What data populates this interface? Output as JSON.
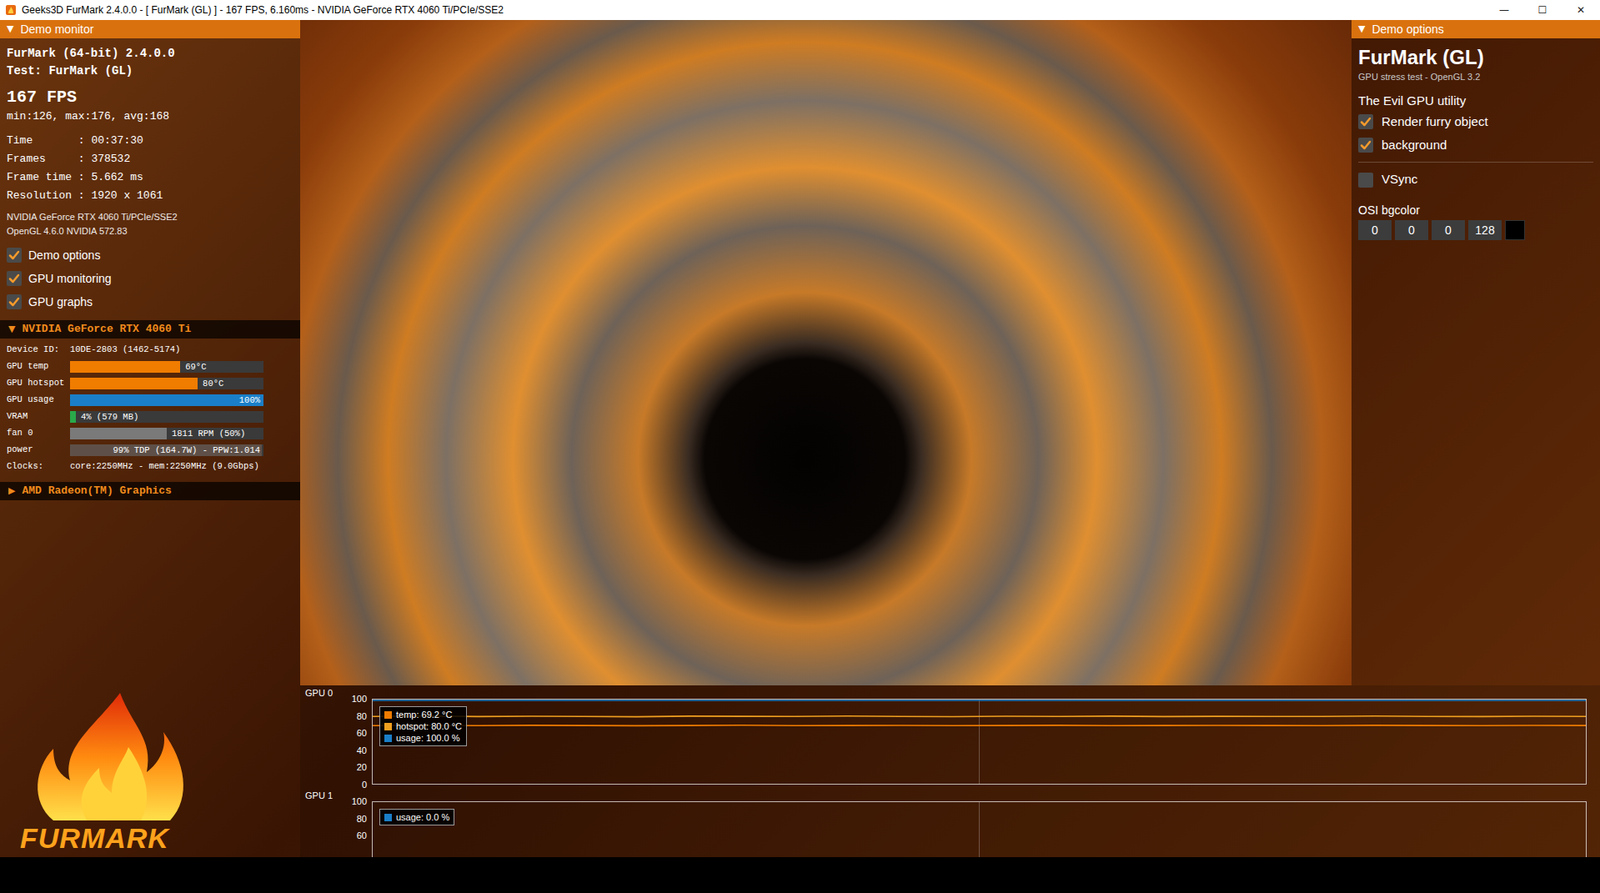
{
  "window": {
    "title": "Geeks3D FurMark 2.4.0.0 - [ FurMark (GL) ] - 167 FPS, 6.160ms - NVIDIA GeForce RTX 4060 Ti/PCIe/SSE2",
    "controls": [
      "—",
      "☐",
      "✕"
    ]
  },
  "demo_monitor": {
    "arrow": "▼",
    "header": "Demo monitor",
    "app": "FurMark (64-bit) 2.4.0.0",
    "test": "Test: FurMark (GL)",
    "fps": "167 FPS",
    "stats": "min:126, max:176, avg:168",
    "info": [
      "Time       : 00:37:30",
      "Frames     : 378532",
      "Frame time : 5.662 ms",
      "Resolution : 1920 x 1061"
    ],
    "renderer": "NVIDIA GeForce RTX 4060 Ti/PCIe/SSE2",
    "opengl": "OpenGL 4.6.0 NVIDIA 572.83",
    "toggles": [
      {
        "label": "Demo options",
        "checked": true
      },
      {
        "label": "GPU monitoring",
        "checked": true
      },
      {
        "label": "GPU graphs",
        "checked": true
      }
    ],
    "gpus": [
      {
        "arrow": "▼",
        "name": "NVIDIA GeForce RTX 4060 Ti",
        "expanded": true,
        "device_label": "Device ID:",
        "device_id": "10DE-2803 (1462-5174)",
        "meters": [
          {
            "label": "GPU temp",
            "level": 0.57,
            "reading": "69°C",
            "color": "#f07c00"
          },
          {
            "label": "GPU hotspot",
            "level": 0.66,
            "reading": "80°C",
            "color": "#f07c00"
          },
          {
            "label": "GPU usage",
            "level": 1.0,
            "reading": "100%",
            "color": "#1a7fc8"
          },
          {
            "label": "VRAM",
            "level": 0.03,
            "reading": "4% (579 MB)",
            "color": "#2aa84a"
          },
          {
            "label": "fan 0",
            "level": 0.5,
            "reading": "1811 RPM (50%)",
            "color": "#7a7a7a"
          },
          {
            "label": "power",
            "level": 0.99,
            "reading": "99% TDP (164.7W) - PPW:1.014",
            "color": "#5e5048"
          }
        ],
        "clocks_label": "Clocks:",
        "clocks": "core:2250MHz - mem:2250MHz (9.0Gbps)"
      },
      {
        "arrow": "▶",
        "name": "AMD Radeon(TM) Graphics",
        "expanded": false
      }
    ]
  },
  "logo": {
    "text": "FURMARK"
  },
  "demo_options": {
    "arrow": "▼",
    "header": "Demo options",
    "title": "FurMark (GL)",
    "subtitle": "GPU stress test - OpenGL 3.2",
    "tagline": "The Evil GPU utility",
    "options": [
      {
        "label": "Render furry object",
        "checked": true
      },
      {
        "label": "background",
        "checked": true
      },
      {
        "label": "VSync",
        "checked": false
      }
    ],
    "bgcolor": {
      "label": "OSI bgcolor",
      "values": [
        "0",
        "0",
        "0",
        "128"
      ],
      "color": "#000000"
    }
  },
  "graphs": [
    {
      "label": "GPU 0",
      "ticks": [
        "100",
        "80",
        "60",
        "40",
        "20",
        "0"
      ],
      "series": [
        {
          "name": "temp",
          "legend": "temp: 69.2 °C",
          "color": "#f07c00",
          "values": [
            69.0,
            69.3,
            69.1,
            69.4,
            69.2,
            68.9,
            69.2,
            69.5,
            69.1,
            69.2,
            69.3,
            69.0,
            69.2,
            69.4,
            69.1,
            69.2,
            69.3,
            69.2,
            69.0,
            69.4,
            69.2,
            69.1,
            69.3,
            69.2
          ]
        },
        {
          "name": "hotspot",
          "legend": "hotspot: 80.0 °C",
          "color": "#f0a020",
          "values": [
            80.0,
            80.4,
            79.8,
            80.2,
            80.0,
            79.6,
            80.3,
            80.1,
            79.9,
            80.4,
            80.0,
            79.7,
            80.2,
            80.0,
            80.3,
            79.8,
            80.1,
            80.0,
            79.9,
            80.5,
            80.0,
            79.8,
            80.2,
            80.0
          ]
        },
        {
          "name": "usage",
          "legend": "usage: 100.0 %",
          "color": "#1a7fc8",
          "values": [
            100,
            100,
            100,
            100,
            100,
            100,
            100,
            100,
            100,
            100,
            100,
            100,
            100,
            100,
            100,
            100,
            100,
            100,
            100,
            100,
            100,
            100,
            100,
            100
          ]
        }
      ]
    },
    {
      "label": "GPU 1",
      "ticks": [
        "100",
        "80",
        "60"
      ],
      "series": [
        {
          "name": "usage",
          "legend": "usage: 0.0 %",
          "color": "#1a7fc8",
          "values": [
            0,
            0,
            0,
            0,
            0,
            0,
            0,
            0,
            0,
            0,
            0,
            0,
            0,
            0,
            0,
            0,
            0,
            0,
            0,
            0,
            0,
            0,
            0,
            0
          ]
        }
      ]
    }
  ]
}
